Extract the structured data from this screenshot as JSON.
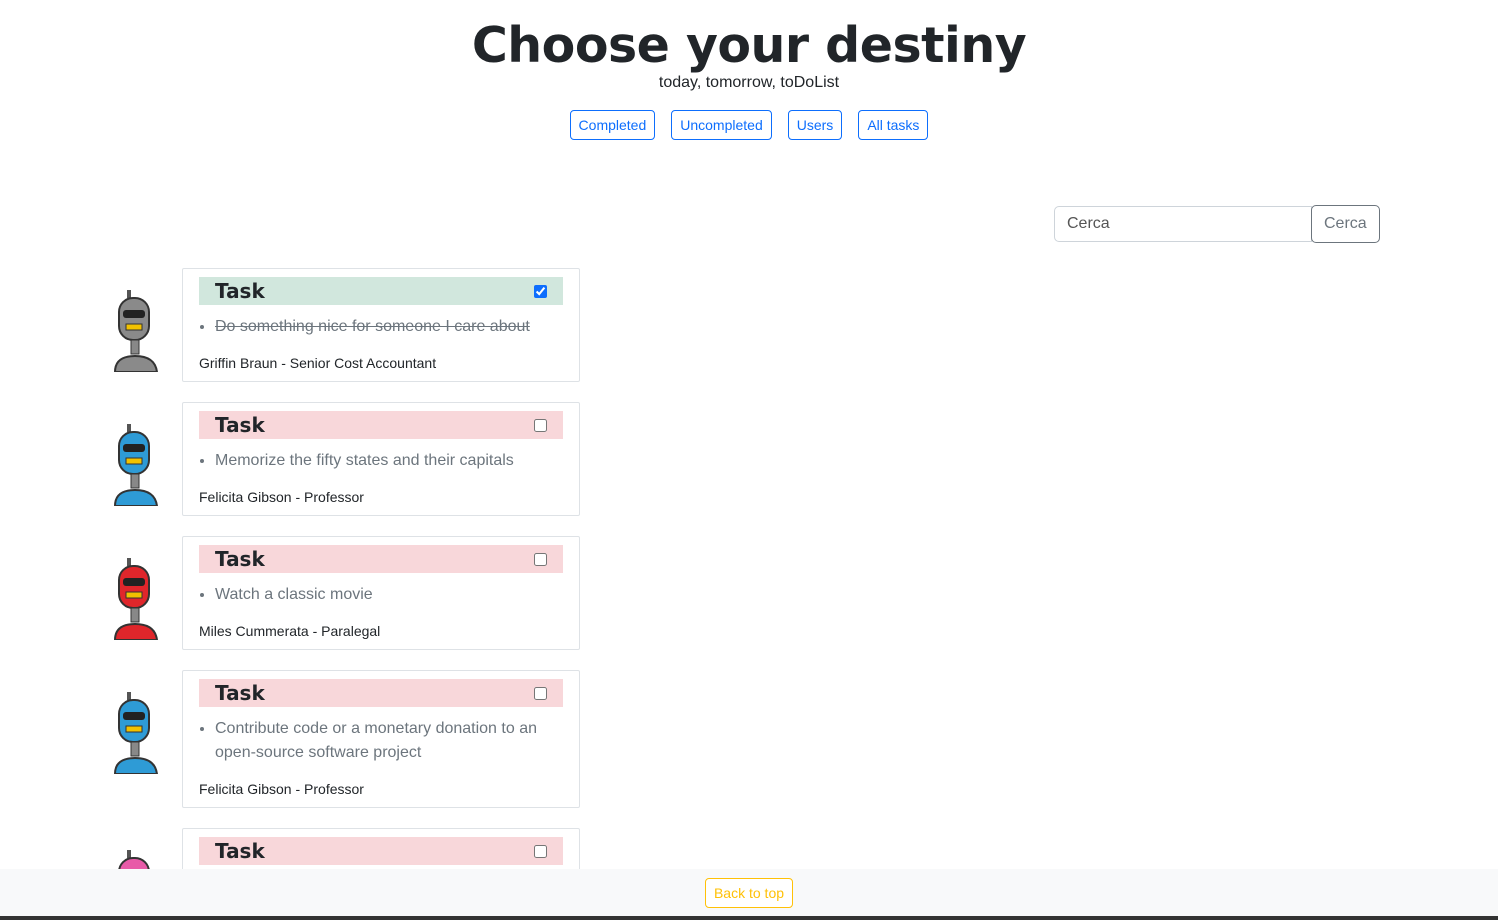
{
  "header": {
    "title": "Choose your destiny",
    "subtitle": "today, tomorrow, toDoList"
  },
  "filters": [
    "Completed",
    "Uncompleted",
    "Users",
    "All tasks"
  ],
  "search": {
    "placeholder": "Cerca",
    "button_label": "Cerca"
  },
  "tasks": [
    {
      "title": "Task",
      "completed": true,
      "text": "Do something nice for someone I care about",
      "user": "Griffin Braun - Senior Cost Accountant",
      "avatar_color": "#8a8a8a",
      "avatar_icon": "gray-robot-icon"
    },
    {
      "title": "Task",
      "completed": false,
      "text": "Memorize the fifty states and their capitals",
      "user": "Felicita Gibson - Professor",
      "avatar_color": "#2e9bd6",
      "avatar_icon": "blue-robot-icon"
    },
    {
      "title": "Task",
      "completed": false,
      "text": "Watch a classic movie",
      "user": "Miles Cummerata - Paralegal",
      "avatar_color": "#e0262b",
      "avatar_icon": "red-robot-icon"
    },
    {
      "title": "Task",
      "completed": false,
      "text": "Contribute code or a monetary donation to an open-source software project",
      "user": "Felicita Gibson - Professor",
      "avatar_color": "#2e9bd6",
      "avatar_icon": "blue-robot-icon"
    },
    {
      "title": "Task",
      "completed": false,
      "text": "",
      "user": "",
      "avatar_color": "#e85aa8",
      "avatar_icon": "pink-robot-icon"
    }
  ],
  "footer": {
    "back_label": "Back to top"
  },
  "colors": {
    "primary": "#0d6efd",
    "done_bg": "#d1e7dd",
    "todo_bg": "#f8d7da",
    "warning": "#ffc107"
  }
}
